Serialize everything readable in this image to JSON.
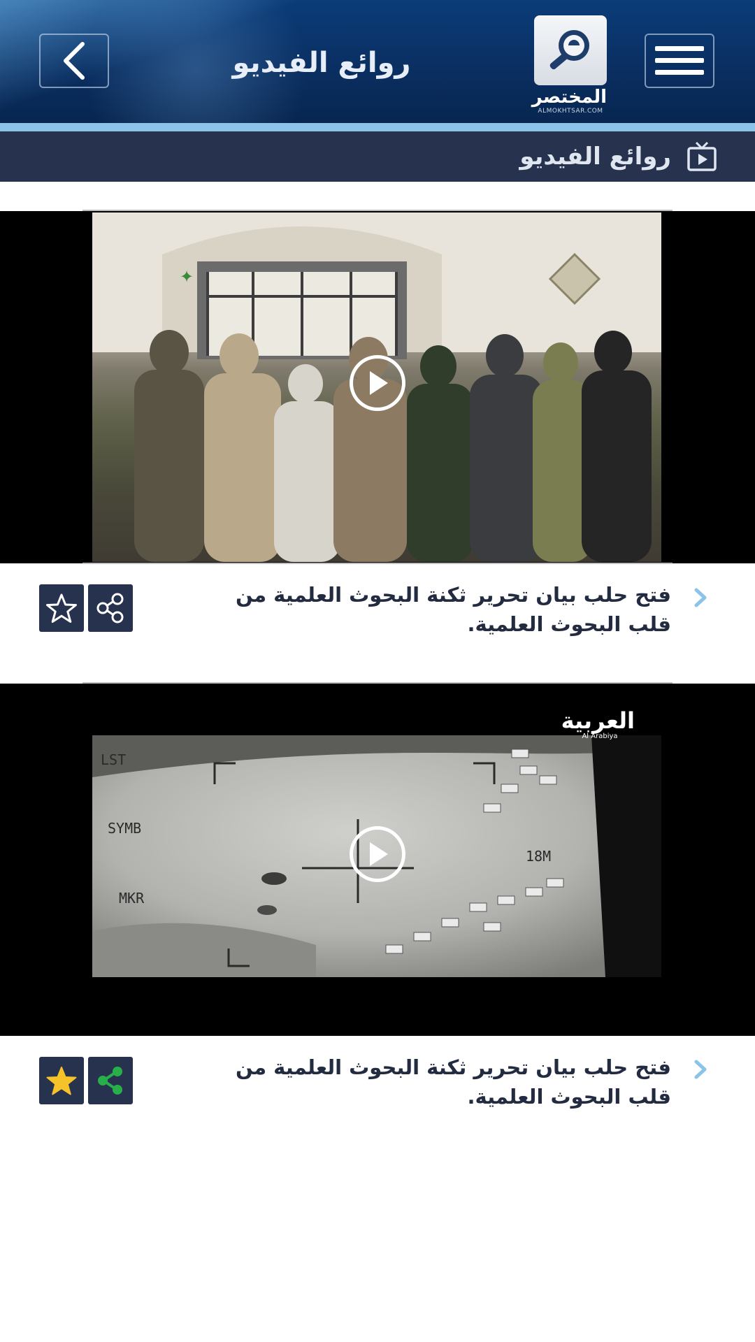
{
  "header": {
    "title": "روائع الفيديو",
    "logo_name": "المختصر",
    "logo_site": "ALMOKHTSAR.COM"
  },
  "section": {
    "title": "روائع الفيديو"
  },
  "videos": [
    {
      "title": "فتح حلب بيان تحرير ثكنة البحوث العلمية من قلب البحوث العلمية.",
      "favorited": false,
      "shared": false
    },
    {
      "title": "فتح حلب بيان تحرير ثكنة البحوث العلمية من قلب البحوث العلمية.",
      "favorited": true,
      "shared": true,
      "overlay": {
        "channel_logo": "العربية",
        "channel_sub": "Al Arabiya",
        "hud_1": "LST",
        "hud_2": "SYMB",
        "hud_3": "MKR",
        "hud_4": "18M"
      }
    }
  ],
  "colors": {
    "header_dark": "#0a2f62",
    "accent_stripe": "#8cc3e8",
    "section_bg": "#27324e",
    "star_active": "#f6c22a",
    "share_active": "#27b04a"
  }
}
